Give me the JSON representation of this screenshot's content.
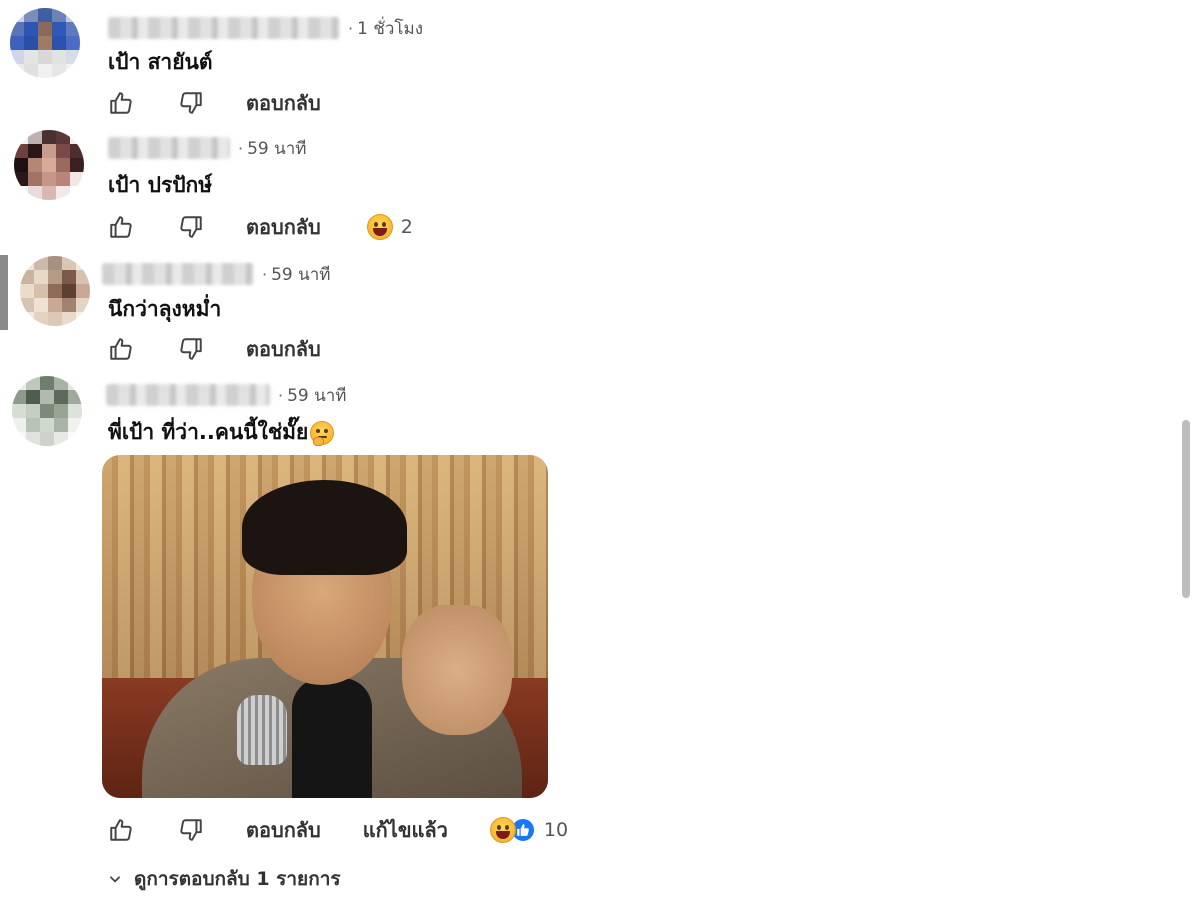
{
  "comments": [
    {
      "time": "1 ชั่วโมง",
      "text": "เป้า สายันต์",
      "reply_label": "ตอบกลับ",
      "reaction_count": ""
    },
    {
      "time": "59 นาที",
      "text": "เป้า ปรปักษ์",
      "reply_label": "ตอบกลับ",
      "reaction_count": "2"
    },
    {
      "time": "59 นาที",
      "text": "นึกว่าลุงหม่ำ",
      "reply_label": "ตอบกลับ",
      "reaction_count": ""
    },
    {
      "time": "59 นาที",
      "text": "พี่เป้า ที่ว่า..คนนี้ใช่มั๊ย",
      "reply_label": "ตอบกลับ",
      "edited_label": "แก้ไขแล้ว",
      "reaction_count": "10"
    }
  ],
  "view_replies": "ดูการตอบกลับ 1 รายการ",
  "icons": {
    "like": "thumbs-up-icon",
    "dislike": "thumbs-down-icon",
    "haha": "laughing-emoji-icon",
    "thinking": "thinking-emoji-icon",
    "like_badge": "like-badge-icon",
    "chevron": "chevron-down-icon"
  },
  "colors": {
    "text": "#111111",
    "meta": "#555555",
    "like_blue": "#1877f2",
    "scrollbar": "#bdbdbd"
  }
}
